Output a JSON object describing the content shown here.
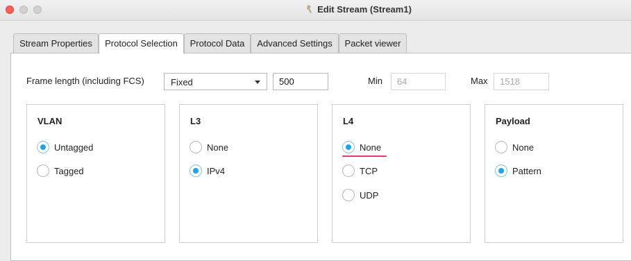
{
  "window": {
    "title": "Edit Stream (Stream1)"
  },
  "tabs": [
    {
      "label": "Stream Properties",
      "active": false
    },
    {
      "label": "Protocol Selection",
      "active": true
    },
    {
      "label": "Protocol Data",
      "active": false
    },
    {
      "label": "Advanced Settings",
      "active": false
    },
    {
      "label": "Packet viewer",
      "active": false
    }
  ],
  "frame": {
    "label": "Frame length (including FCS)",
    "mode": "Fixed",
    "value": "500",
    "min_label": "Min",
    "min_value": "64",
    "max_label": "Max",
    "max_value": "1518"
  },
  "groups": [
    {
      "title": "VLAN",
      "options": [
        {
          "label": "Untagged",
          "checked": true
        },
        {
          "label": "Tagged",
          "checked": false
        }
      ]
    },
    {
      "title": "L3",
      "options": [
        {
          "label": "None",
          "checked": false
        },
        {
          "label": "IPv4",
          "checked": true
        }
      ]
    },
    {
      "title": "L4",
      "options": [
        {
          "label": "None",
          "checked": true
        },
        {
          "label": "TCP",
          "checked": false
        },
        {
          "label": "UDP",
          "checked": false
        }
      ]
    },
    {
      "title": "Payload",
      "options": [
        {
          "label": "None",
          "checked": false
        },
        {
          "label": "Pattern",
          "checked": true
        }
      ]
    }
  ],
  "colors": {
    "accent": "#1ea5e6",
    "highlight_underline": "#e8386d",
    "close_button": "#fe5f57"
  }
}
